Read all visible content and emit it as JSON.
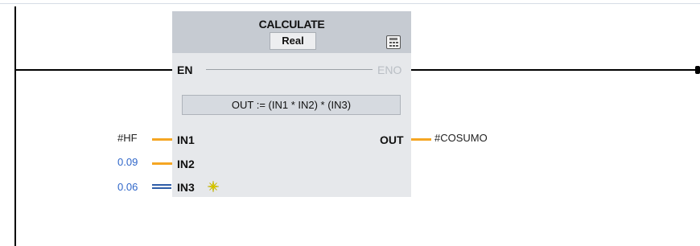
{
  "block": {
    "title": "CALCULATE",
    "data_type": "Real",
    "icon": "calculator-icon",
    "en_label": "EN",
    "eno_label": "ENO",
    "formula": "OUT :=   (IN1 * IN2) * (IN3)"
  },
  "inputs": [
    {
      "pin": "IN1",
      "operand": "#HF"
    },
    {
      "pin": "IN2",
      "operand": "0.09"
    },
    {
      "pin": "IN3",
      "operand": "0.06"
    }
  ],
  "outputs": [
    {
      "pin": "OUT",
      "operand": "#COSUMO"
    }
  ],
  "colors": {
    "wire": "#f5a623",
    "constant_text": "#2f66c9",
    "block_header": "#c6cbd2",
    "block_body": "#e6e8eb"
  }
}
